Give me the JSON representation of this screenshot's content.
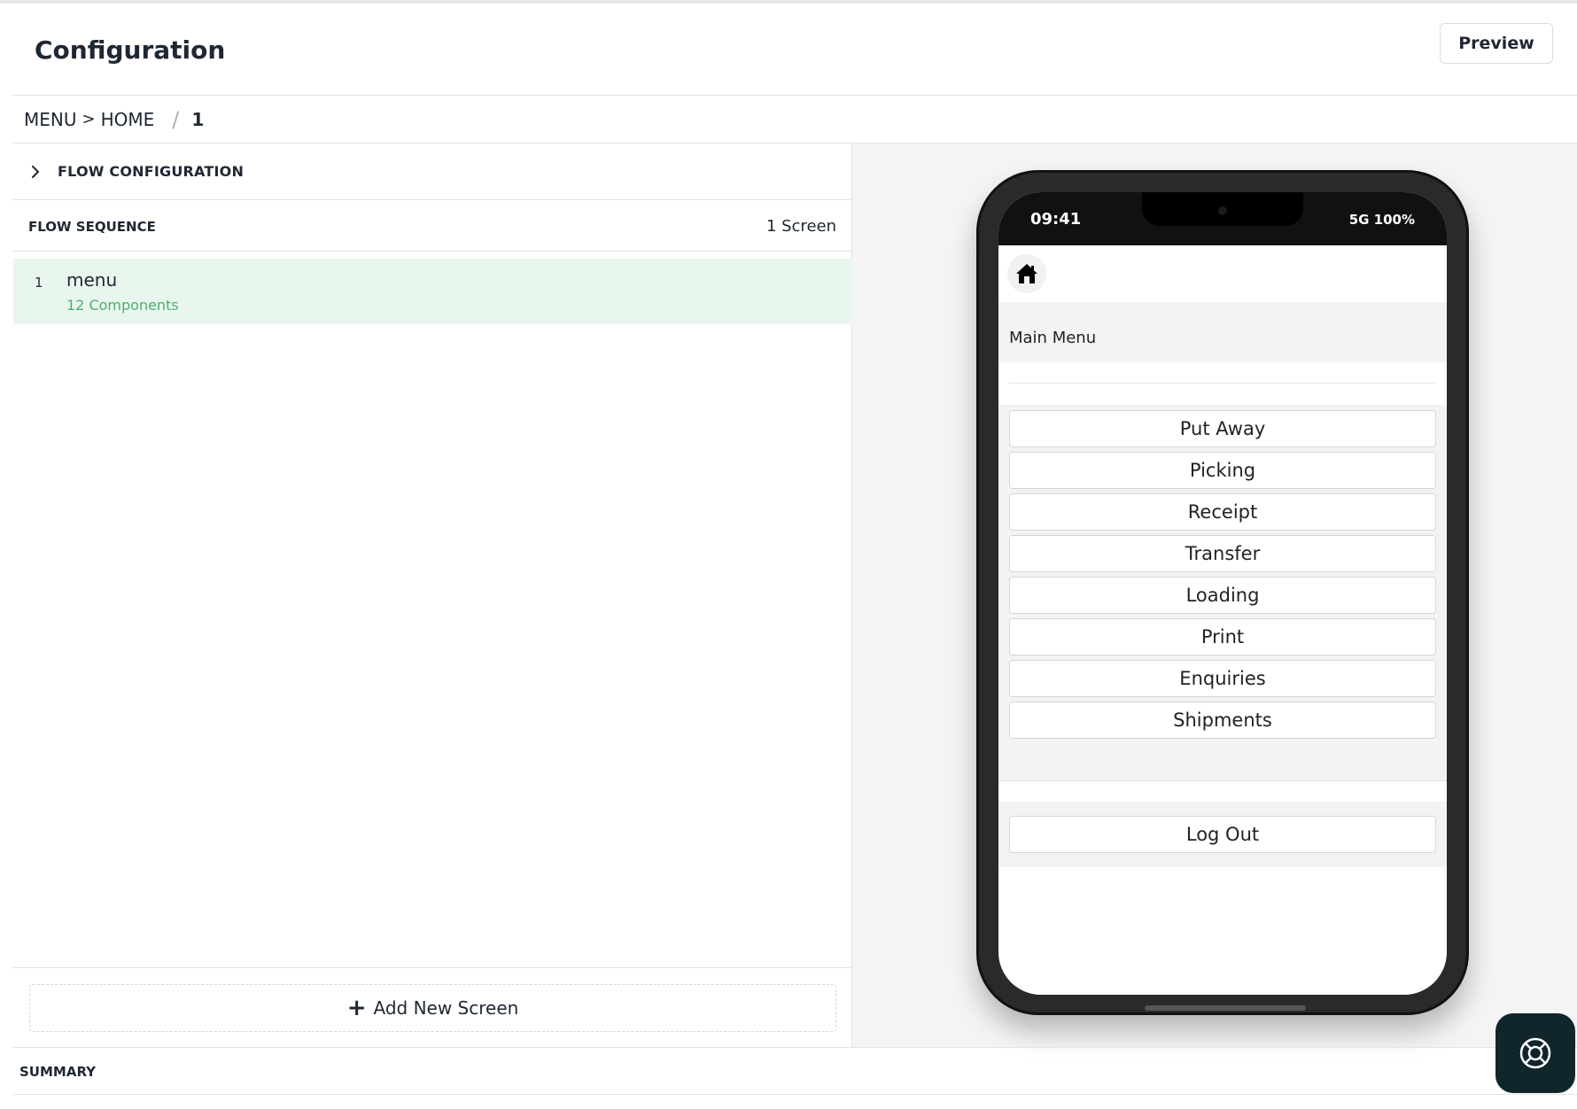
{
  "header": {
    "title": "Configuration",
    "preview_label": "Preview"
  },
  "breadcrumb": {
    "items": [
      "MENU",
      "HOME"
    ],
    "arrow": ">",
    "separator": "/",
    "current": "1"
  },
  "flow_config": {
    "label": "FLOW CONFIGURATION",
    "icon": "chevron-right-icon"
  },
  "flow_sequence": {
    "label": "FLOW SEQUENCE",
    "count": "1 Screen",
    "screens": [
      {
        "number": "1",
        "name": "menu",
        "subtitle": "12 Components"
      }
    ]
  },
  "add_screen": {
    "label": "Add New Screen",
    "icon": "plus-icon"
  },
  "phone": {
    "time": "09:41",
    "network": "5G  100%",
    "home_icon": "home-icon",
    "title": "Main Menu",
    "buttons": [
      "Put Away",
      "Picking",
      "Receipt",
      "Transfer",
      "Loading",
      "Print",
      "Enquiries",
      "Shipments"
    ],
    "logout": "Log Out"
  },
  "summary": {
    "label": "SUMMARY"
  },
  "help": {
    "icon": "lifebuoy-icon"
  },
  "colors": {
    "accent_green": "#4caf6f",
    "selected_row_bg": "#e9f6ee",
    "fab_bg": "#10262b"
  }
}
